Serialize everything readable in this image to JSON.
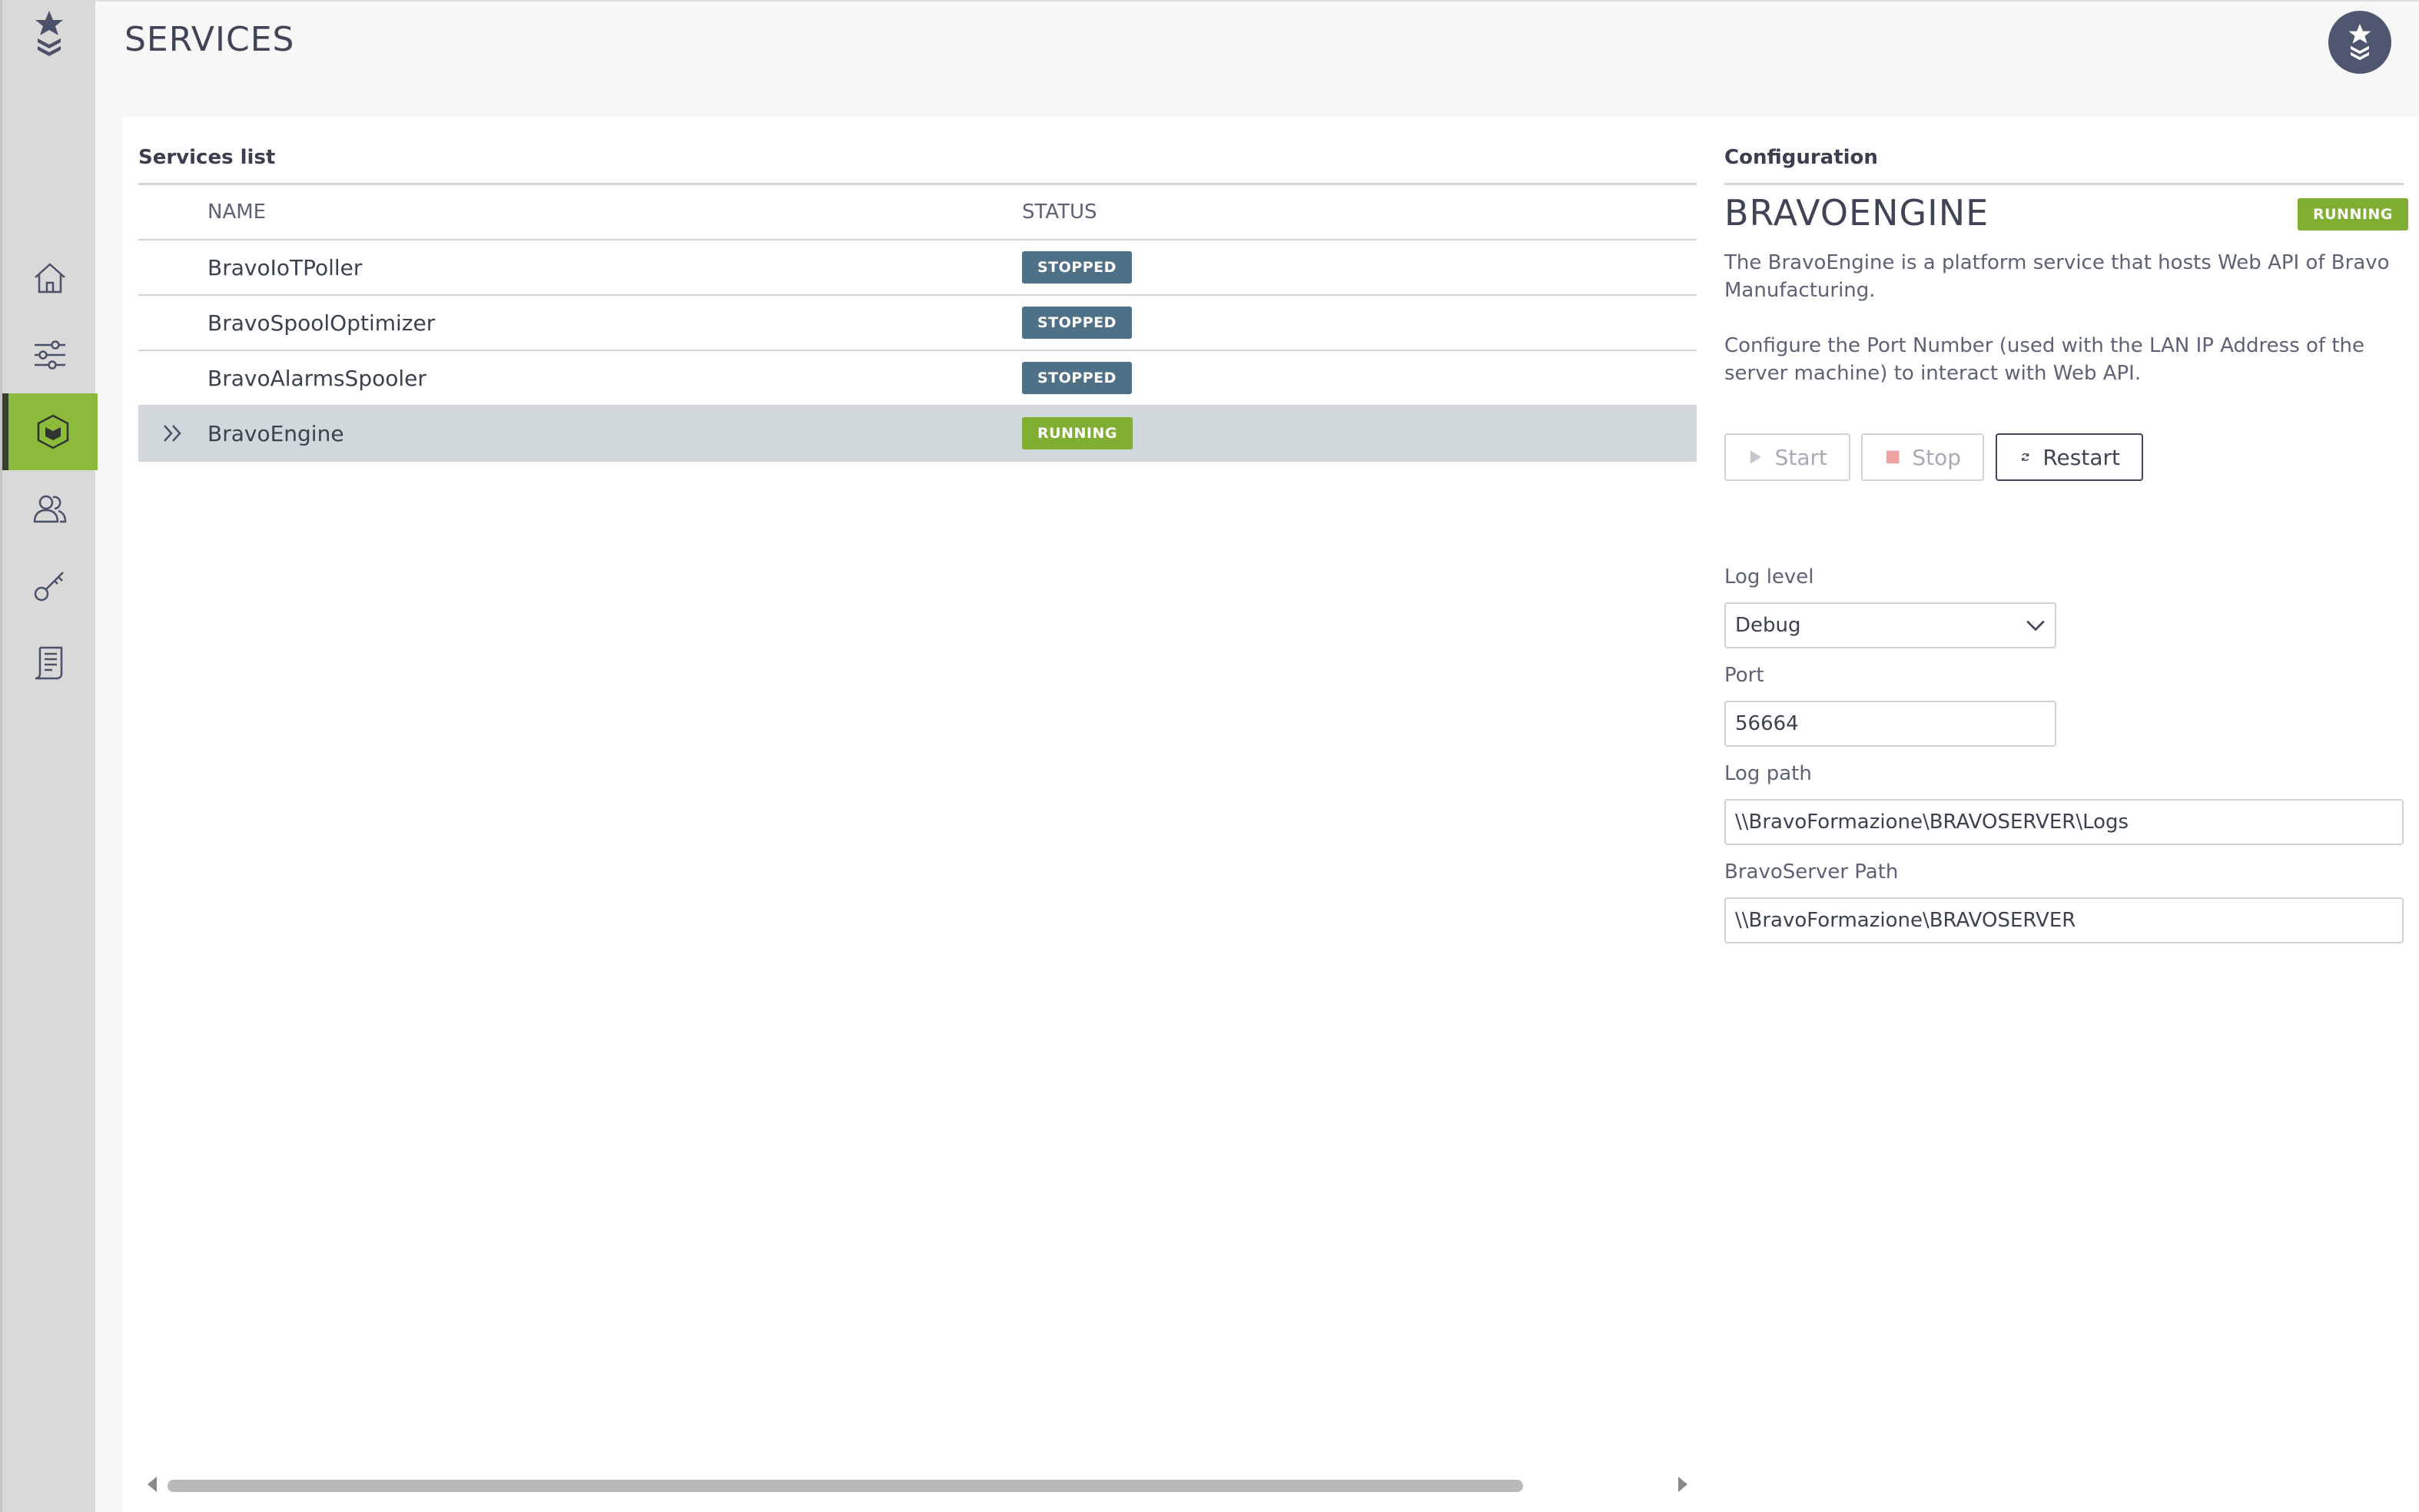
{
  "app": {
    "page_title": "SERVICES"
  },
  "sidebar": {
    "items": [
      {
        "icon": "home-icon",
        "name": "home"
      },
      {
        "icon": "sliders-icon",
        "name": "settings"
      },
      {
        "icon": "cube-icon",
        "name": "services",
        "active": true
      },
      {
        "icon": "users-icon",
        "name": "users"
      },
      {
        "icon": "key-icon",
        "name": "licenses"
      },
      {
        "icon": "log-document-icon",
        "name": "logs"
      }
    ],
    "active_color": "#8cbb3c"
  },
  "services_list": {
    "title": "Services list",
    "columns": {
      "name": "NAME",
      "status": "STATUS"
    },
    "rows": [
      {
        "name": "BravoIoTPoller",
        "status": "STOPPED"
      },
      {
        "name": "BravoSpoolOptimizer",
        "status": "STOPPED"
      },
      {
        "name": "BravoAlarmsSpooler",
        "status": "STOPPED"
      },
      {
        "name": "BravoEngine",
        "status": "RUNNING",
        "selected": true
      }
    ]
  },
  "configuration": {
    "title": "Configuration",
    "service_name": "BRAVOENGINE",
    "status": "RUNNING",
    "description_1": "The BravoEngine is a platform service that hosts Web API of Bravo Manufacturing.",
    "description_2": "Configure the Port Number (used with the LAN IP Address of the server machine) to interact with Web API.",
    "buttons": {
      "start": "Start",
      "stop": "Stop",
      "restart": "Restart"
    },
    "log_level": {
      "label": "Log level",
      "value": "Debug"
    },
    "port": {
      "label": "Port",
      "value": "56664"
    },
    "log_path": {
      "label": "Log path",
      "value": "\\\\BravoFormazione\\BRAVOSERVER\\Logs"
    },
    "server_path": {
      "label": "BravoServer Path",
      "value": "\\\\BravoFormazione\\BRAVOSERVER"
    }
  },
  "colors": {
    "stopped": "#4e7187",
    "running": "#7fae32",
    "selected_row": "#d1d8db"
  }
}
